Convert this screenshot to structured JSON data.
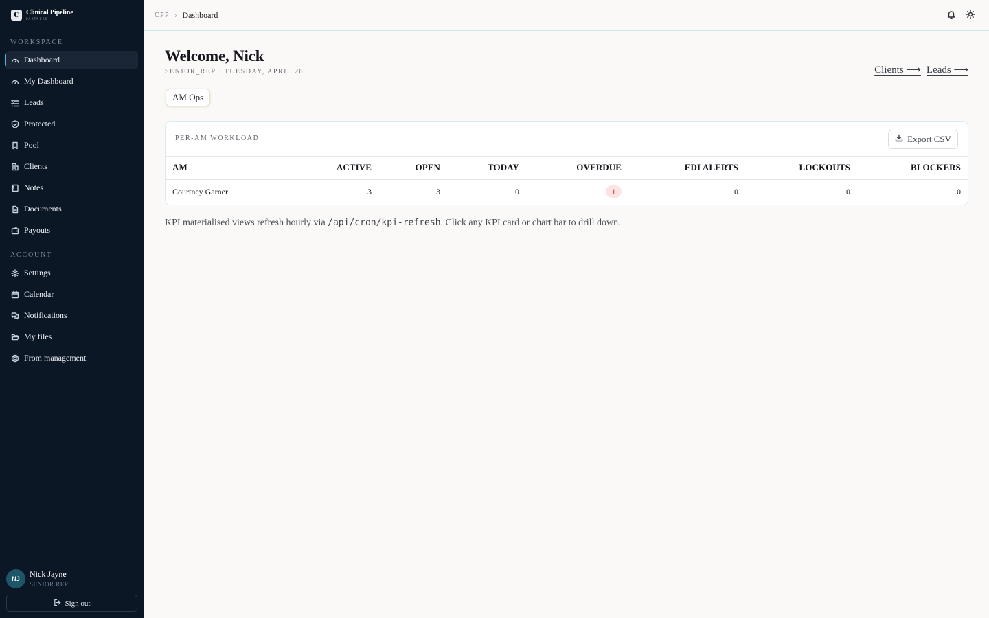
{
  "brand": {
    "name": "Clinical Pipeline",
    "sub": "PARTNERS"
  },
  "sidebar": {
    "workspace_label": "WORKSPACE",
    "workspace_items": [
      {
        "label": "Dashboard",
        "icon": "gauge-icon",
        "active": true
      },
      {
        "label": "My Dashboard",
        "icon": "gauge-icon"
      },
      {
        "label": "Leads",
        "icon": "list-check-icon"
      },
      {
        "label": "Protected",
        "icon": "shield-check-icon"
      },
      {
        "label": "Pool",
        "icon": "bookmark-icon"
      },
      {
        "label": "Clients",
        "icon": "building-icon"
      },
      {
        "label": "Notes",
        "icon": "notebook-icon"
      },
      {
        "label": "Documents",
        "icon": "document-icon"
      },
      {
        "label": "Payouts",
        "icon": "wallet-icon"
      }
    ],
    "account_label": "ACCOUNT",
    "account_items": [
      {
        "label": "Settings",
        "icon": "gear-icon"
      },
      {
        "label": "Calendar",
        "icon": "calendar-icon"
      },
      {
        "label": "Notifications",
        "icon": "messages-icon"
      },
      {
        "label": "My files",
        "icon": "folder-open-icon"
      },
      {
        "label": "From management",
        "icon": "lifebuoy-icon"
      }
    ],
    "user": {
      "initials": "NJ",
      "name": "Nick Jayne",
      "role": "SENIOR REP"
    },
    "signout_label": "Sign out"
  },
  "topbar": {
    "breadcrumb_root": "CPP",
    "breadcrumb_current": "Dashboard"
  },
  "main": {
    "welcome": "Welcome, Nick",
    "subline": "SENIOR_REP · TUESDAY, APRIL 28",
    "links": {
      "clients": "Clients ⟶",
      "leads": "Leads ⟶"
    },
    "chip": "AM Ops",
    "card": {
      "title": "PER-AM WORKLOAD",
      "export_label": "Export CSV",
      "columns": [
        "AM",
        "ACTIVE",
        "OPEN",
        "TODAY",
        "OVERDUE",
        "EDI ALERTS",
        "LOCKOUTS",
        "BLOCKERS"
      ],
      "rows": [
        {
          "am": "Courtney Garner",
          "active": "3",
          "open": "3",
          "today": "0",
          "overdue": "1",
          "edi_alerts": "0",
          "lockouts": "0",
          "blockers": "0"
        }
      ]
    },
    "note": {
      "before": "KPI materialised views refresh hourly via ",
      "code": "/api/cron/kpi-refresh",
      "after": ". Click any KPI card or chart bar to drill down."
    }
  },
  "colors": {
    "sidebar_bg": "#0c1725",
    "accent": "#49b8d6",
    "overdue_badge": "#fde4e4"
  }
}
